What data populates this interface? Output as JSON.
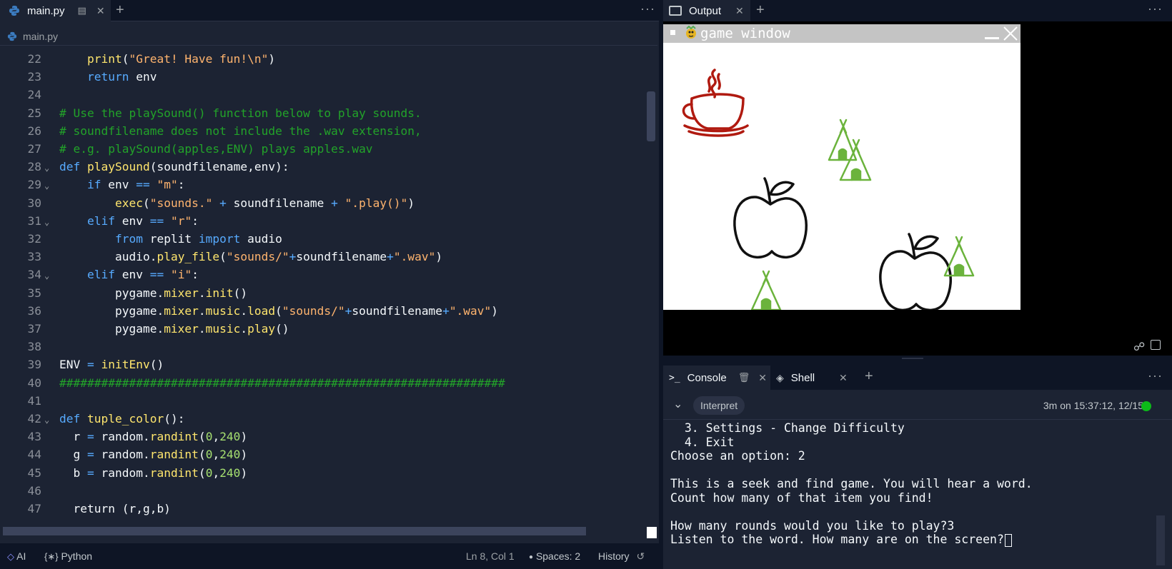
{
  "editor": {
    "tab_label": "main.py",
    "breadcrumb": "main.py",
    "lines": [
      {
        "n": "22",
        "fold": false,
        "tokens": [
          [
            "op",
            "    "
          ],
          [
            "fn",
            "print"
          ],
          [
            "op",
            "("
          ],
          [
            "str",
            "\"Great! Have fun!\\n\""
          ],
          [
            "op",
            ")"
          ]
        ]
      },
      {
        "n": "23",
        "fold": false,
        "tokens": [
          [
            "op",
            "    "
          ],
          [
            "kw",
            "return"
          ],
          [
            "op",
            " env"
          ]
        ]
      },
      {
        "n": "24",
        "fold": false,
        "tokens": []
      },
      {
        "n": "25",
        "fold": false,
        "tokens": [
          [
            "com",
            "# Use the playSound() function below to play sounds."
          ]
        ]
      },
      {
        "n": "26",
        "fold": false,
        "tokens": [
          [
            "com",
            "# soundfilename does not include the .wav extension,"
          ]
        ]
      },
      {
        "n": "27",
        "fold": false,
        "tokens": [
          [
            "com",
            "# e.g. playSound(apples,ENV) plays apples.wav"
          ]
        ]
      },
      {
        "n": "28",
        "fold": true,
        "tokens": [
          [
            "kw",
            "def"
          ],
          [
            "op",
            " "
          ],
          [
            "fn",
            "playSound"
          ],
          [
            "op",
            "(soundfilename,env):"
          ]
        ]
      },
      {
        "n": "29",
        "fold": true,
        "tokens": [
          [
            "op",
            "    "
          ],
          [
            "kw",
            "if"
          ],
          [
            "op",
            " env "
          ],
          [
            "kw",
            "=="
          ],
          [
            "op",
            " "
          ],
          [
            "str",
            "\"m\""
          ],
          [
            "op",
            ":"
          ]
        ]
      },
      {
        "n": "30",
        "fold": false,
        "tokens": [
          [
            "op",
            "        "
          ],
          [
            "fn",
            "exec"
          ],
          [
            "op",
            "("
          ],
          [
            "str",
            "\"sounds.\""
          ],
          [
            "op",
            " "
          ],
          [
            "kw",
            "+"
          ],
          [
            "op",
            " soundfilename "
          ],
          [
            "kw",
            "+"
          ],
          [
            "op",
            " "
          ],
          [
            "str",
            "\".play()\""
          ],
          [
            "op",
            ")"
          ]
        ]
      },
      {
        "n": "31",
        "fold": true,
        "tokens": [
          [
            "op",
            "    "
          ],
          [
            "kw",
            "elif"
          ],
          [
            "op",
            " env "
          ],
          [
            "kw",
            "=="
          ],
          [
            "op",
            " "
          ],
          [
            "str",
            "\"r\""
          ],
          [
            "op",
            ":"
          ]
        ]
      },
      {
        "n": "32",
        "fold": false,
        "tokens": [
          [
            "op",
            "        "
          ],
          [
            "kw",
            "from"
          ],
          [
            "op",
            " replit "
          ],
          [
            "kw",
            "import"
          ],
          [
            "op",
            " audio"
          ]
        ]
      },
      {
        "n": "33",
        "fold": false,
        "tokens": [
          [
            "op",
            "        audio."
          ],
          [
            "fn",
            "play_file"
          ],
          [
            "op",
            "("
          ],
          [
            "str",
            "\"sounds/\""
          ],
          [
            "kw",
            "+"
          ],
          [
            "op",
            "soundfilename"
          ],
          [
            "kw",
            "+"
          ],
          [
            "str",
            "\".wav\""
          ],
          [
            "op",
            ")"
          ]
        ]
      },
      {
        "n": "34",
        "fold": true,
        "tokens": [
          [
            "op",
            "    "
          ],
          [
            "kw",
            "elif"
          ],
          [
            "op",
            " env "
          ],
          [
            "kw",
            "=="
          ],
          [
            "op",
            " "
          ],
          [
            "str",
            "\"i\""
          ],
          [
            "op",
            ":"
          ]
        ]
      },
      {
        "n": "35",
        "fold": false,
        "tokens": [
          [
            "op",
            "        pygame."
          ],
          [
            "fn",
            "mixer"
          ],
          [
            "op",
            "."
          ],
          [
            "fn",
            "init"
          ],
          [
            "op",
            "()"
          ]
        ]
      },
      {
        "n": "36",
        "fold": false,
        "tokens": [
          [
            "op",
            "        pygame."
          ],
          [
            "fn",
            "mixer"
          ],
          [
            "op",
            "."
          ],
          [
            "fn",
            "music"
          ],
          [
            "op",
            "."
          ],
          [
            "fn",
            "load"
          ],
          [
            "op",
            "("
          ],
          [
            "str",
            "\"sounds/\""
          ],
          [
            "kw",
            "+"
          ],
          [
            "op",
            "soundfilename"
          ],
          [
            "kw",
            "+"
          ],
          [
            "str",
            "\".wav\""
          ],
          [
            "op",
            ")"
          ]
        ]
      },
      {
        "n": "37",
        "fold": false,
        "tokens": [
          [
            "op",
            "        pygame."
          ],
          [
            "fn",
            "mixer"
          ],
          [
            "op",
            "."
          ],
          [
            "fn",
            "music"
          ],
          [
            "op",
            "."
          ],
          [
            "fn",
            "play"
          ],
          [
            "op",
            "()"
          ]
        ]
      },
      {
        "n": "38",
        "fold": false,
        "tokens": []
      },
      {
        "n": "39",
        "fold": false,
        "tokens": [
          [
            "op",
            "ENV "
          ],
          [
            "kw",
            "="
          ],
          [
            "op",
            " "
          ],
          [
            "fn",
            "initEnv"
          ],
          [
            "op",
            "()"
          ]
        ]
      },
      {
        "n": "40",
        "fold": false,
        "tokens": [
          [
            "com",
            "################################################################"
          ]
        ]
      },
      {
        "n": "41",
        "fold": false,
        "tokens": []
      },
      {
        "n": "42",
        "fold": true,
        "tokens": [
          [
            "kw",
            "def"
          ],
          [
            "op",
            " "
          ],
          [
            "fn",
            "tuple_color"
          ],
          [
            "op",
            "():"
          ]
        ]
      },
      {
        "n": "43",
        "fold": false,
        "tokens": [
          [
            "op",
            "  r "
          ],
          [
            "kw",
            "="
          ],
          [
            "op",
            " random."
          ],
          [
            "fn",
            "randint"
          ],
          [
            "op",
            "("
          ],
          [
            "num",
            "0"
          ],
          [
            "op",
            ","
          ],
          [
            "num",
            "240"
          ],
          [
            "op",
            ")"
          ]
        ]
      },
      {
        "n": "44",
        "fold": false,
        "tokens": [
          [
            "op",
            "  g "
          ],
          [
            "kw",
            "="
          ],
          [
            "op",
            " random."
          ],
          [
            "fn",
            "randint"
          ],
          [
            "op",
            "("
          ],
          [
            "num",
            "0"
          ],
          [
            "op",
            ","
          ],
          [
            "num",
            "240"
          ],
          [
            "op",
            ")"
          ]
        ]
      },
      {
        "n": "45",
        "fold": false,
        "tokens": [
          [
            "op",
            "  b "
          ],
          [
            "kw",
            "="
          ],
          [
            "op",
            " random."
          ],
          [
            "fn",
            "randint"
          ],
          [
            "op",
            "("
          ],
          [
            "num",
            "0"
          ],
          [
            "op",
            ","
          ],
          [
            "num",
            "240"
          ],
          [
            "op",
            ")"
          ]
        ]
      },
      {
        "n": "46",
        "fold": false,
        "tokens": []
      },
      {
        "n": "47",
        "fold": false,
        "tokens": [
          [
            "op",
            "  return (r,g,b)"
          ]
        ]
      }
    ]
  },
  "statusbar": {
    "ai": "AI",
    "language": "Python",
    "position": "Ln 8, Col 1",
    "spaces": "Spaces: 2",
    "history": "History"
  },
  "output": {
    "tab_label": "Output",
    "window_title": "game window"
  },
  "console": {
    "tab_console": "Console",
    "tab_shell": "Shell",
    "interpret": "Interpret",
    "run_info": "3m on 15:37:12, 12/15",
    "status_color": "#0cba19",
    "lines": [
      "  3. Settings - Change Difficulty",
      "  4. Exit",
      "Choose an option: 2",
      "",
      "This is a seek and find game. You will hear a word.",
      "Count how many of that item you find!",
      "",
      "How many rounds would you like to play?3",
      "Listen to the word. How many are on the screen?"
    ]
  },
  "colors": {
    "bg": "#0e1525",
    "panel": "#1c2333",
    "keyword": "#57abff",
    "function": "#ffe66d",
    "string": "#ffb46e",
    "number": "#a6e070",
    "comment": "#22a329",
    "teacup": "#b01a10",
    "tipi": "#6bb33c"
  }
}
